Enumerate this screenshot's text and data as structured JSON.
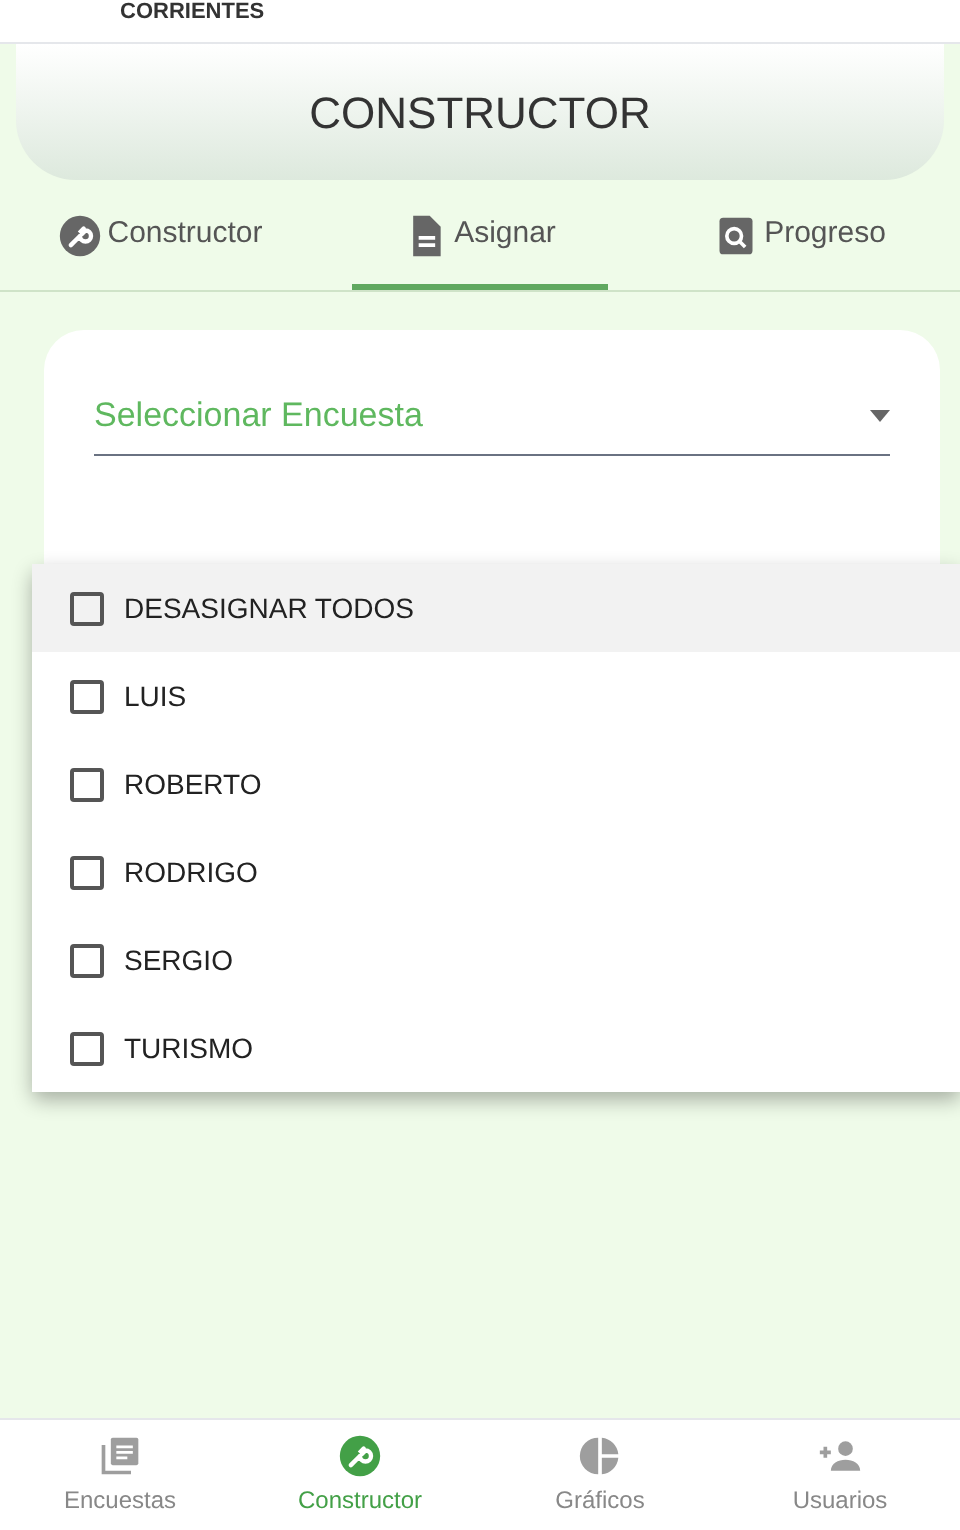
{
  "header": {
    "brand": "CORRIENTES"
  },
  "title": "CONSTRUCTOR",
  "tabs": [
    {
      "label": "Constructor",
      "kind": "wrench",
      "selected": false
    },
    {
      "label": "Asignar",
      "kind": "doc",
      "selected": true
    },
    {
      "label": "Progreso",
      "kind": "search",
      "selected": false
    }
  ],
  "survey_select": {
    "placeholder": "Seleccionar Encuesta"
  },
  "assign_menu": [
    {
      "label": "DESASIGNAR TODOS",
      "checked": false,
      "highlighted": true
    },
    {
      "label": "LUIS",
      "checked": false,
      "highlighted": false
    },
    {
      "label": "ROBERTO",
      "checked": false,
      "highlighted": false
    },
    {
      "label": "RODRIGO",
      "checked": false,
      "highlighted": false
    },
    {
      "label": "SERGIO",
      "checked": false,
      "highlighted": false
    },
    {
      "label": "TURISMO",
      "checked": false,
      "highlighted": false
    }
  ],
  "bottom_nav": [
    {
      "label": "Encuestas",
      "kind": "list",
      "selected": false
    },
    {
      "label": "Constructor",
      "kind": "wrench",
      "selected": true
    },
    {
      "label": "Gráficos",
      "kind": "pie",
      "selected": false
    },
    {
      "label": "Usuarios",
      "kind": "adduser",
      "selected": false
    }
  ]
}
